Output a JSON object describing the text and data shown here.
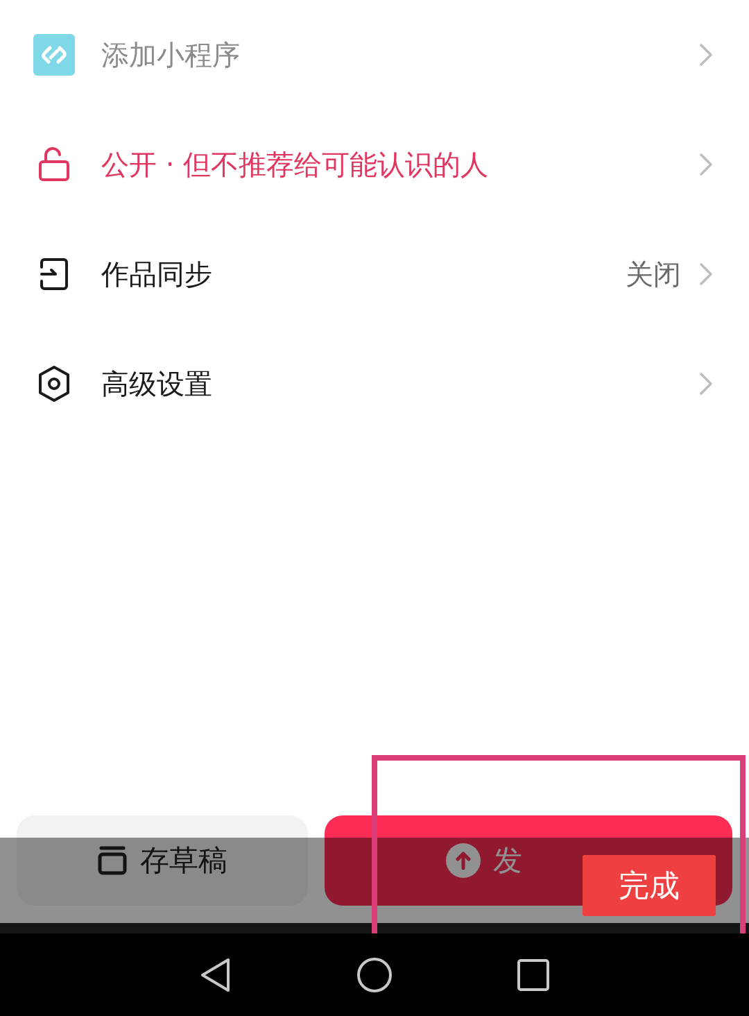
{
  "rows": [
    {
      "kind": "mini-program",
      "label": "添加小程序",
      "color": "#8a8a8a"
    },
    {
      "kind": "visibility",
      "label": "公开 · 但不推荐给可能认识的人",
      "color": "#e0365f"
    },
    {
      "kind": "sync",
      "label": "作品同步",
      "value": "关闭",
      "color": "#1a1a1a"
    },
    {
      "kind": "advanced",
      "label": "高级设置",
      "color": "#1a1a1a"
    }
  ],
  "actions": [
    {
      "kind": "draft",
      "label": "存草稿"
    },
    {
      "kind": "publish",
      "label": "发"
    }
  ],
  "done_button": "完成"
}
